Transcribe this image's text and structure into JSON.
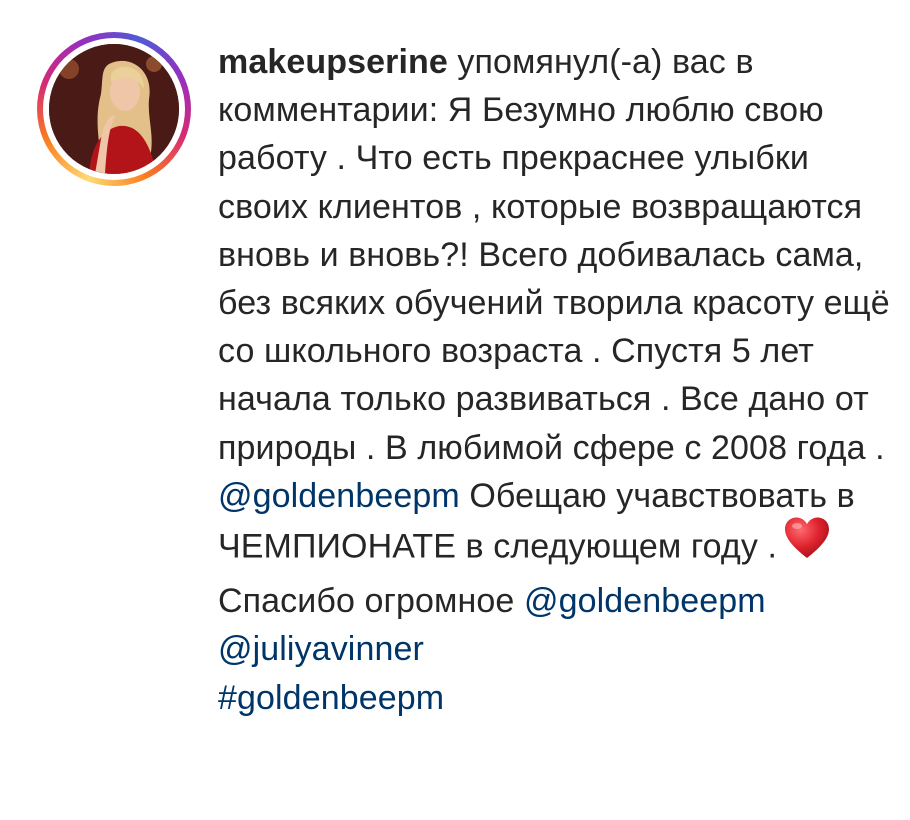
{
  "notification": {
    "username": "makeupserine",
    "action_text": " упомянул(-а) вас в комментарии: ",
    "paragraph1": "Я Безумно люблю свою работу . Что есть прекраснее улыбки своих клиентов , которые возвращаются вновь и вновь?! Всего добивалась сама, без всяких обучений творила красоту ещё со школьного возраста . Спустя 5 лет начала только развиваться . Все дано от природы . В любимой сфере с 2008 года .",
    "mention1": "@goldenbeepm",
    "paragraph2": " Обещаю учавствовать в ЧЕМПИОНАТЕ в следующем году .",
    "heart_icon": "red-heart-emoji",
    "thanks_text": "Спасибо огромное ",
    "mention2": "@goldenbeepm",
    "mention3": "@juliyavinner",
    "hashtag": "#goldenbeepm"
  },
  "colors": {
    "text": "#262626",
    "link": "#003569",
    "heart": "#e0242f",
    "ring_gradient": [
      "#feda75",
      "#fa7e1e",
      "#d62976",
      "#962fbf",
      "#4f5bd5"
    ]
  }
}
